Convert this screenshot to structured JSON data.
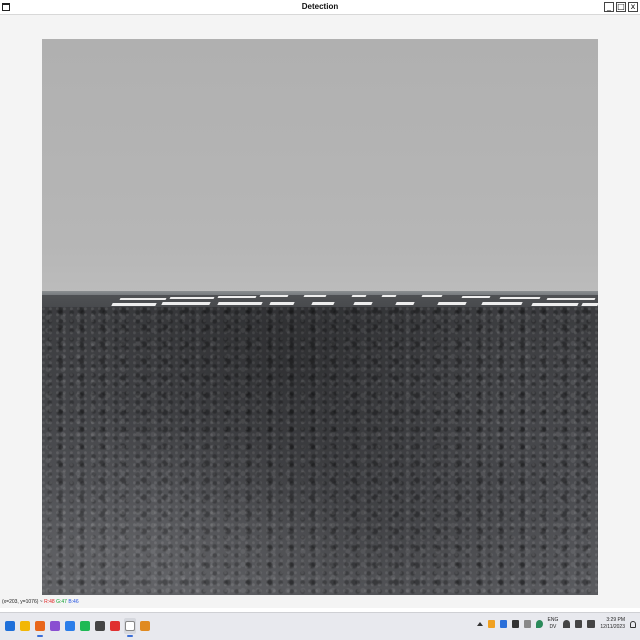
{
  "window": {
    "title": "Detection",
    "controls": {
      "minimize": "_",
      "maximize": "□",
      "close": "x"
    }
  },
  "statusbar": {
    "coords": "(x=203, y=1076)",
    "separator": " ~ ",
    "r": "R:48",
    "g": "G:47",
    "b": "B:46"
  },
  "taskbar": {
    "apps": [
      {
        "icon": "windows-start-icon",
        "color": "#1e6fd9"
      },
      {
        "icon": "file-explorer-icon",
        "color": "#f2b705"
      },
      {
        "icon": "firefox-icon",
        "color": "#e8661a"
      },
      {
        "icon": "visual-studio-icon",
        "color": "#8a4fd1"
      },
      {
        "icon": "tasks-icon",
        "color": "#2b7de9"
      },
      {
        "icon": "spotify-icon",
        "color": "#1db954"
      },
      {
        "icon": "terminal-icon",
        "color": "#444444"
      },
      {
        "icon": "record-icon",
        "color": "#e03030"
      },
      {
        "icon": "python-app-icon",
        "color": "#ffffff"
      },
      {
        "icon": "paint-icon",
        "color": "#e08a20"
      }
    ],
    "tray": {
      "language_top": "ENG",
      "language_bottom": "DV",
      "time": "3:29 PM",
      "date": "12/11/2023"
    }
  }
}
